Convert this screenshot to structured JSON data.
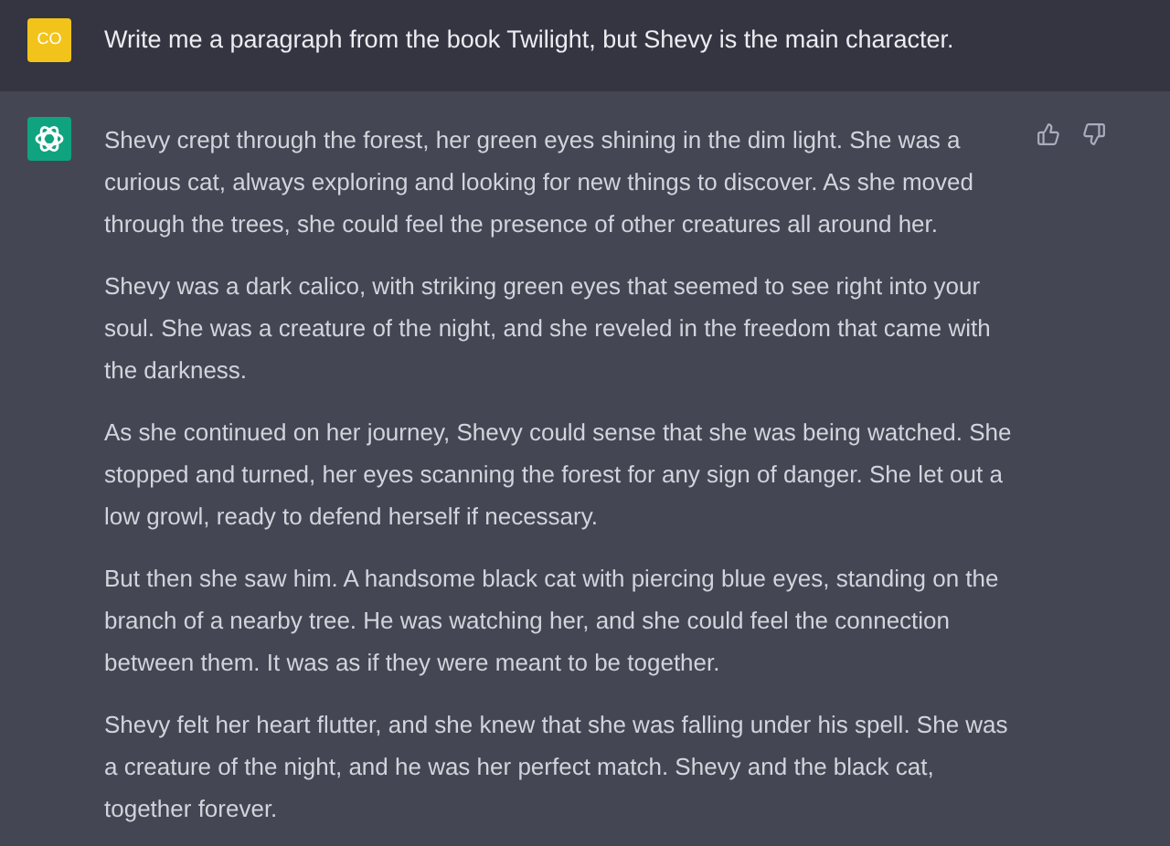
{
  "prompt": {
    "avatar": "CO",
    "text": "Write me a paragraph from the book Twilight, but Shevy is the main character."
  },
  "response": {
    "paragraphs": [
      "Shevy crept through the forest, her green eyes shining in the dim light. She was a curious cat, always exploring and looking for new things to discover. As she moved through the trees, she could feel the presence of other creatures all around her.",
      "Shevy was a dark calico, with striking green eyes that seemed to see right into your soul. She was a creature of the night, and she reveled in the freedom that came with the darkness.",
      "As she continued on her journey, Shevy could sense that she was being watched. She stopped and turned, her eyes scanning the forest for any sign of danger. She let out a low growl, ready to defend herself if necessary.",
      "But then she saw him. A handsome black cat with piercing blue eyes, standing on the branch of a nearby tree. He was watching her, and she could feel the connection between them. It was as if they were meant to be together.",
      "Shevy felt her heart flutter, and she knew that she was falling under his spell. She was a creature of the night, and he was her perfect match. Shevy and the black cat, together forever."
    ]
  }
}
